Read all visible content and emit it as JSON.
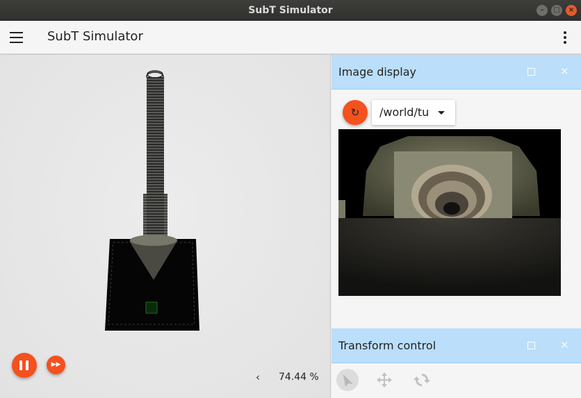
{
  "window": {
    "title": "SubT Simulator"
  },
  "appbar": {
    "title": "SubT Simulator",
    "menu_icon": "hamburger-menu-icon",
    "overflow_icon": "more-vert-icon"
  },
  "scene": {
    "rtf_value": "74.44 %",
    "collapse_icon": "chevron-left-icon",
    "play_state": "running"
  },
  "image_display": {
    "title": "Image display",
    "topic": "/world/tu",
    "refresh_glyph": "↻"
  },
  "transform_control": {
    "title": "Transform control",
    "tools": [
      "select-icon",
      "translate-icon",
      "rotate-icon"
    ]
  },
  "colors": {
    "accent": "#f4511e",
    "panel_header": "#bbdefb",
    "titlebar": "#2f2f2d"
  }
}
